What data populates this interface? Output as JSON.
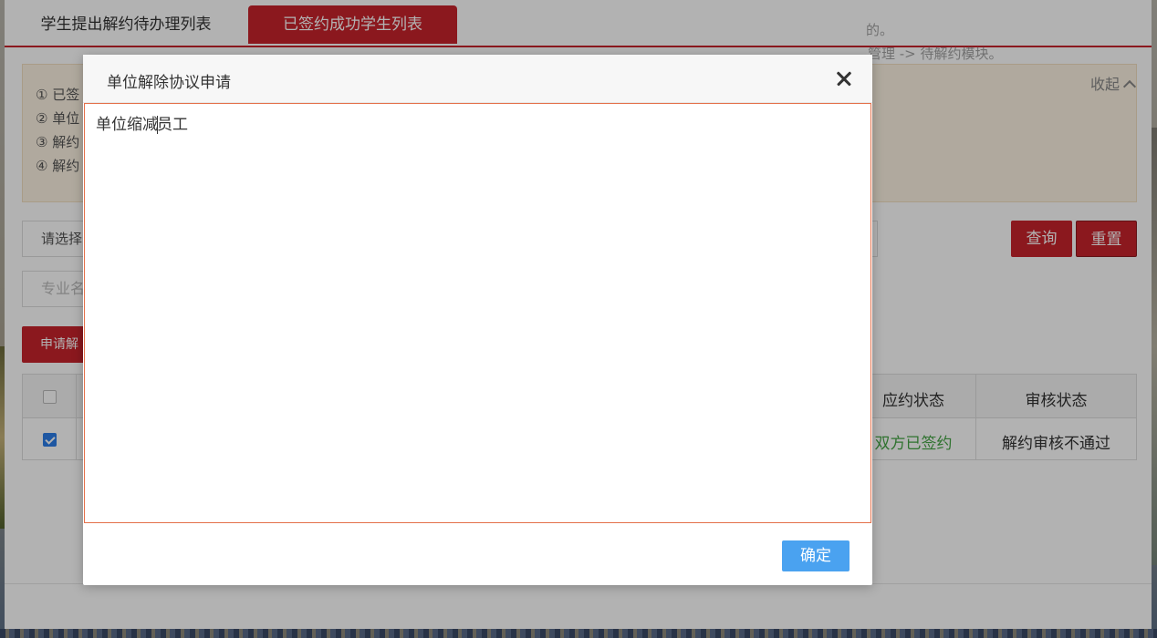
{
  "tabs": {
    "pending": "学生提出解约待办理列表",
    "signed": "已签约成功学生列表"
  },
  "notice": {
    "line1": "① 已签",
    "line2": "② 单位",
    "line3": "③ 解约",
    "line4": "④ 解约",
    "line1_tail": "的。",
    "line2_tail": "管理 -> 待解约模块。",
    "collapse_label": "收起"
  },
  "filters": {
    "select_placeholder": "请选择",
    "major_placeholder": "专业名",
    "query_label": "查询",
    "reset_label": "重置"
  },
  "actions": {
    "apply_label": "申请解"
  },
  "table": {
    "headers": [
      "应约状态",
      "审核状态"
    ],
    "rows": [
      {
        "checked": true,
        "status": "双方已签约",
        "review": "解约审核不通过"
      }
    ],
    "status_color": "#46a546"
  },
  "modal": {
    "title": "单位解除协议申请",
    "text_before_caret": "单位缩减",
    "text_after_caret": "员工",
    "confirm_label": "确定"
  },
  "colors": {
    "brand": "#c8232c",
    "confirm": "#4aa2f0",
    "textarea_focus": "#e4704a"
  }
}
